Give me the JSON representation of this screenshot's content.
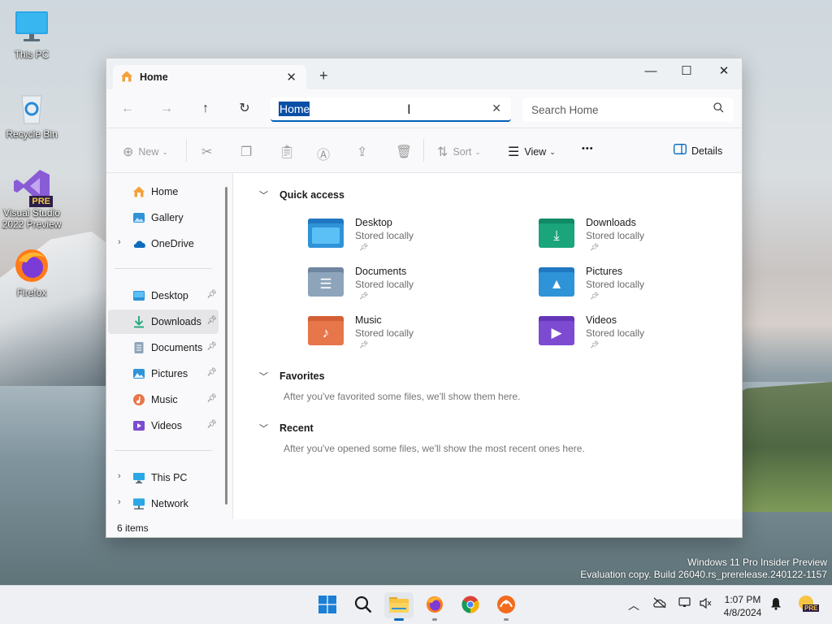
{
  "desktop": {
    "icons": [
      {
        "label": "This PC"
      },
      {
        "label": "Recycle Bin"
      },
      {
        "label": "Visual Studio 2022 Preview",
        "badge": "PRE"
      },
      {
        "label": "Firefox"
      }
    ],
    "watermark": {
      "line1": "Windows 11 Pro Insider Preview",
      "line2": "Evaluation copy. Build 26040.rs_prerelease.240122-1157"
    }
  },
  "window": {
    "tab": {
      "title": "Home",
      "close_glyph": "✕",
      "icon": "home-icon"
    },
    "new_tab_glyph": "+",
    "controls": {
      "minimize": "—",
      "maximize": "☐",
      "close": "✕"
    },
    "address": {
      "value": "Home",
      "clear_glyph": "✕"
    },
    "search": {
      "placeholder": "Search Home",
      "icon": "search-icon"
    },
    "nav": {
      "back": "←",
      "forward": "→",
      "up": "↑",
      "refresh": "↻"
    },
    "toolbar": {
      "new_label": "New",
      "sort_label": "Sort",
      "view_label": "View",
      "more_label": "•••",
      "details_label": "Details"
    },
    "sidebar": {
      "home": "Home",
      "gallery": "Gallery",
      "onedrive": "OneDrive",
      "pinned": [
        {
          "label": "Desktop"
        },
        {
          "label": "Downloads"
        },
        {
          "label": "Documents"
        },
        {
          "label": "Pictures"
        },
        {
          "label": "Music"
        },
        {
          "label": "Videos"
        }
      ],
      "this_pc": "This PC",
      "network": "Network"
    },
    "content": {
      "quick_access": {
        "title": "Quick access",
        "items": [
          {
            "name": "Desktop",
            "sub": "Stored locally"
          },
          {
            "name": "Downloads",
            "sub": "Stored locally"
          },
          {
            "name": "Documents",
            "sub": "Stored locally"
          },
          {
            "name": "Pictures",
            "sub": "Stored locally"
          },
          {
            "name": "Music",
            "sub": "Stored locally"
          },
          {
            "name": "Videos",
            "sub": "Stored locally"
          }
        ]
      },
      "favorites": {
        "title": "Favorites",
        "empty": "After you've favorited some files, we'll show them here."
      },
      "recent": {
        "title": "Recent",
        "empty": "After you've opened some files, we'll show the most recent ones here."
      }
    },
    "status": {
      "items": "6 items"
    }
  },
  "taskbar": {
    "clock": {
      "time": "1:07 PM",
      "date": "4/8/2024"
    },
    "apps": [
      "start-icon",
      "search-icon",
      "file-explorer-icon",
      "firefox-icon",
      "chrome-icon",
      "app-icon"
    ],
    "preview_badge": "PRE"
  },
  "colors": {
    "accent": "#005fb8",
    "selection": "#0a4fa6",
    "folder_blue": "#2f93d8",
    "folder_teal": "#1aa57a",
    "folder_orange": "#e7764b",
    "folder_purple": "#7d4bd1"
  }
}
